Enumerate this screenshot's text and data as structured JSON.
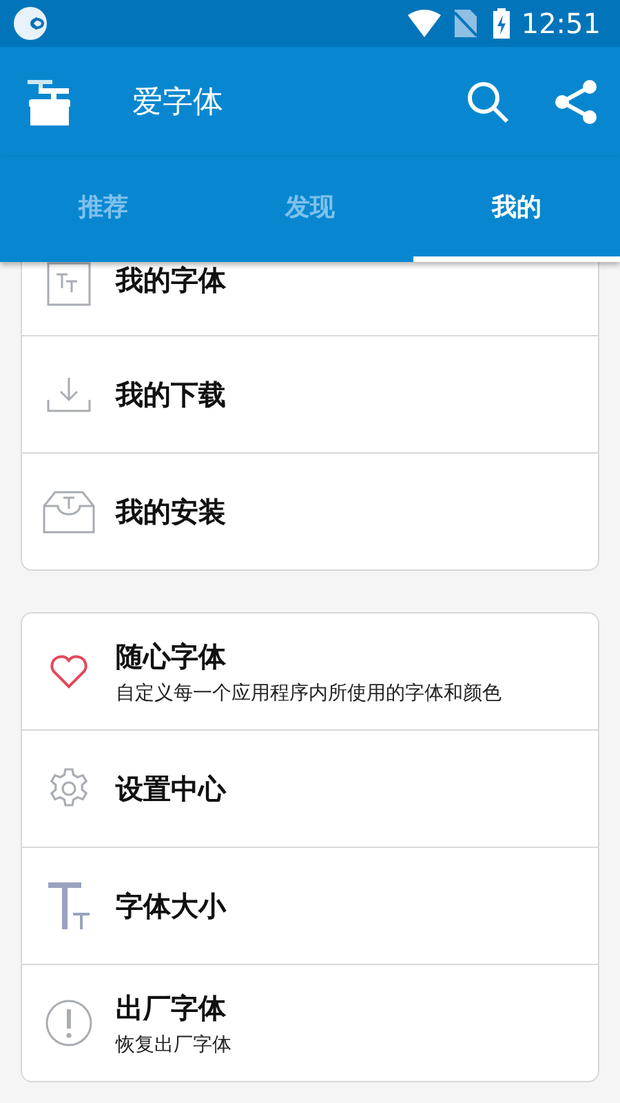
{
  "status_bar": {
    "time": "12:51"
  },
  "app_bar": {
    "title": "爱字体"
  },
  "tabs": [
    {
      "label": "推荐",
      "selected": false
    },
    {
      "label": "发现",
      "selected": false
    },
    {
      "label": "我的",
      "selected": true
    }
  ],
  "sections": [
    {
      "items": [
        {
          "title": "我的字体"
        },
        {
          "title": "我的下载"
        },
        {
          "title": "我的安装"
        }
      ]
    },
    {
      "items": [
        {
          "title": "随心字体",
          "subtitle": "自定义每一个应用程序内所使用的字体和颜色"
        },
        {
          "title": "设置中心"
        },
        {
          "title": "字体大小"
        },
        {
          "title": "出厂字体",
          "subtitle": "恢复出厂字体"
        }
      ]
    }
  ]
}
